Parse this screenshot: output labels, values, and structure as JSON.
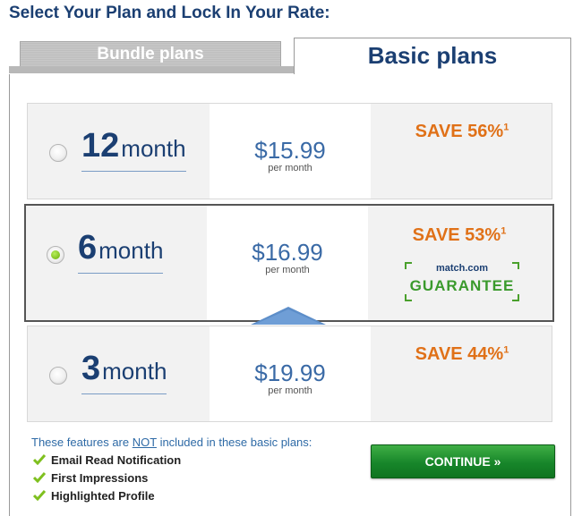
{
  "page": {
    "title": "Select Your Plan and Lock In Your Rate:"
  },
  "tabs": [
    {
      "label": "Bundle plans",
      "active": false
    },
    {
      "label": "Basic plans",
      "active": true
    }
  ],
  "plans": [
    {
      "term_num": "12",
      "term_unit": "month",
      "price": "$15.99",
      "per": "per month",
      "save": "SAVE 56%",
      "footnote": "1",
      "selected": false
    },
    {
      "term_num": "6",
      "term_unit": "month",
      "price": "$16.99",
      "per": "per month",
      "save": "SAVE 53%",
      "footnote": "1",
      "selected": true,
      "guarantee": {
        "brand": "match.com",
        "label": "GUARANTEE"
      }
    },
    {
      "term_num": "3",
      "term_unit": "month",
      "price": "$19.99",
      "per": "per month",
      "save": "SAVE 44%",
      "footnote": "1",
      "selected": false
    }
  ],
  "features": {
    "intro_prefix": "These features are ",
    "intro_not": "NOT",
    "intro_suffix": " included in these basic plans:",
    "items": [
      "Email Read Notification",
      "First Impressions",
      "Highlighted Profile"
    ]
  },
  "continue_button": {
    "label": "CONTINUE »"
  },
  "colors": {
    "brand_blue": "#1b3f72",
    "save_orange": "#e07118",
    "continue_green": "#17862a"
  }
}
